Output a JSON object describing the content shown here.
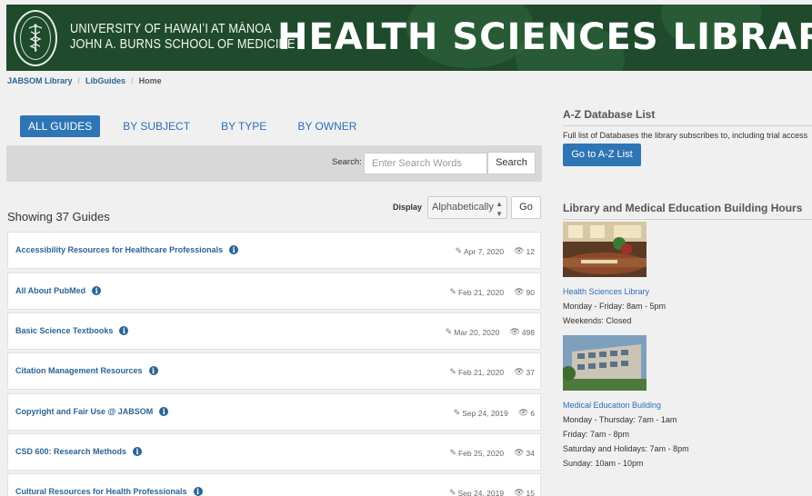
{
  "header": {
    "university_line1": "UNIVERSITY OF HAWAIʻI AT MĀNOA",
    "university_line2": "JOHN A. BURNS SCHOOL OF MEDICINE",
    "library_title": "HEALTH SCIENCES LIBRARY",
    "seal_icon": "caduceus-seal-icon"
  },
  "breadcrumb": [
    "JABSOM Library",
    "LibGuides",
    "Home"
  ],
  "tabs": [
    "ALL GUIDES",
    "BY SUBJECT",
    "BY TYPE",
    "BY OWNER"
  ],
  "search": {
    "label": "Search:",
    "placeholder": "Enter Search Words",
    "button": "Search"
  },
  "display": {
    "label": "Display",
    "selected": "Alphabetically",
    "go": "Go"
  },
  "showing": "Showing 37 Guides",
  "guides": [
    {
      "title": "Accessibility Resources for Healthcare Professionals",
      "date": "Apr 7, 2020",
      "views": "12"
    },
    {
      "title": "All About PubMed",
      "date": "Feb 21, 2020",
      "views": "90"
    },
    {
      "title": "Basic Science Textbooks",
      "date": "Mar 20, 2020",
      "views": "498"
    },
    {
      "title": "Citation Management Resources",
      "date": "Feb 21, 2020",
      "views": "37"
    },
    {
      "title": "Copyright and Fair Use @ JABSOM",
      "date": "Sep 24, 2019",
      "views": "6"
    },
    {
      "title": "CSD 600: Research Methods",
      "date": "Feb 25, 2020",
      "views": "34"
    },
    {
      "title": "Cultural Resources for Health Professionals",
      "date": "Sep 24, 2019",
      "views": "15"
    }
  ],
  "sidebar": {
    "az_heading": "A-Z Database List",
    "az_text": "Full list of Databases the library subscribes to, including trial access",
    "az_button": "Go to A-Z List",
    "hours_heading": "Library and Medical Education Building Hours",
    "hsl_link": "Health Sciences Library",
    "hsl_hours": [
      "Monday - Friday: 8am - 5pm",
      "Weekends: Closed"
    ],
    "meb_link": "Medical Education Building",
    "meb_hours": [
      "Monday - Thursday: 7am - 1am",
      "Friday: 7am - 8pm",
      "Saturday and Holidays: 7am - 8pm",
      "Sunday: 10am - 10pm"
    ]
  },
  "colors": {
    "banner_green": "#1f4a2c",
    "link_blue": "#2a6496",
    "button_blue": "#2e75b6"
  }
}
